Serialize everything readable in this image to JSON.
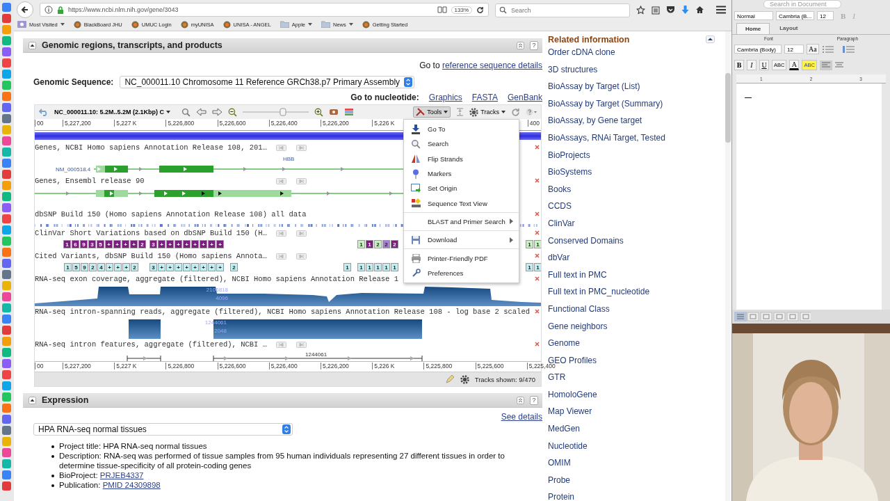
{
  "browser": {
    "url": "https://www.ncbi.nlm.nih.gov/gene/3043",
    "zoom": "133%",
    "search_placeholder": "Search"
  },
  "bookmarks": [
    {
      "label": "Most Visited",
      "kind": "smart",
      "menu": true
    },
    {
      "label": "BlackBoard JHU",
      "kind": "site",
      "menu": false
    },
    {
      "label": "UMUC Login",
      "kind": "site",
      "menu": false
    },
    {
      "label": "myUNISA",
      "kind": "site",
      "menu": false
    },
    {
      "label": "UNISA - ANGEL",
      "kind": "site",
      "menu": false
    },
    {
      "label": "Apple",
      "kind": "folder",
      "menu": true
    },
    {
      "label": "News",
      "kind": "folder",
      "menu": true
    },
    {
      "label": "Getting Started",
      "kind": "site",
      "menu": false
    }
  ],
  "genomic": {
    "title": "Genomic regions, transcripts, and products",
    "help": "?",
    "goto": "Go to",
    "goto_link": "reference sequence details",
    "sequence_label": "Genomic Sequence:",
    "sequence_value": "NC_000011.10 Chromosome 11 Reference GRCh38.p7 Primary Assembly",
    "nucleotide_label": "Go to nucleotide:",
    "nucleotide_links": [
      "Graphics",
      "FASTA",
      "GenBank"
    ]
  },
  "viewer": {
    "region": "NC_000011.10: 5.2M..5.2M (2.1Kbp) C",
    "tools": "Tools",
    "tools_open": true,
    "zoom_slider": {
      "level": 0.62
    },
    "tracks_button": "Tracks",
    "top_ruler": [
      "00",
      "5,227,200",
      "5,227 K",
      "5,226,800",
      "5,226,600",
      "5,226,400",
      "5,226,200",
      "5,226 K",
      "400"
    ],
    "tracks": [
      {
        "title": "Genes, NCBI Homo sapiens Annotation Release 108, 201…",
        "kind": "gene",
        "nav_buttons": true,
        "labels": [
          "NM_000518.4",
          "HBB"
        ]
      },
      {
        "title": "Genes, Ensembl release 90",
        "kind": "gene",
        "nav_buttons": true
      },
      {
        "title": "dbSNP Build 150 (Homo sapiens Annotation Release 108) all data",
        "kind": "snp",
        "nav_buttons": false
      },
      {
        "title": "ClinVar Short Variations based on dbSNP Build 150 (H…",
        "kind": "variant",
        "nav_buttons": true,
        "groups": [
          {
            "color": "#7a1f7d",
            "labels": [
              "1",
              "6",
              "9",
              "3",
              "5",
              "+",
              "+",
              "+",
              "+",
              "2"
            ]
          },
          {
            "color": "#7a1f7d",
            "labels": [
              "3",
              "+",
              "+",
              "+",
              "+",
              "+",
              "+",
              "+",
              "+"
            ]
          },
          {
            "color": "#c8f2c2",
            "labels": [
              "1"
            ]
          },
          {
            "color": "#7a1f7d",
            "labels": [
              "1"
            ]
          },
          {
            "color": "#c8f2c2",
            "labels": [
              "2"
            ]
          },
          {
            "color": "#a77fd9",
            "labels": [
              "2"
            ]
          },
          {
            "color": "#7a1f7d",
            "labels": [
              "2"
            ]
          },
          {
            "color": "#c8f2c2",
            "labels": [
              "1",
              "1"
            ]
          }
        ]
      },
      {
        "title": "Cited Variants, dbSNP Build 150 (Homo sapiens Annota…",
        "kind": "variant",
        "nav_buttons": true,
        "groups": [
          {
            "color": "#bff0f4",
            "labels": [
              "1",
              "5",
              "9",
              "2",
              "4",
              "+",
              "+",
              "+",
              "2"
            ]
          },
          {
            "color": "#bff0f4",
            "labels": [
              "3",
              "+",
              "+",
              "+",
              "+",
              "+",
              "+",
              "+",
              "+"
            ]
          },
          {
            "color": "#bff0f4",
            "labels": [
              "2"
            ]
          },
          {
            "color": "#bff0f4",
            "labels": [
              "1"
            ]
          },
          {
            "color": "#bff0f4",
            "labels": [
              "1",
              "1",
              "1",
              "1",
              "1"
            ]
          },
          {
            "color": "#bff0f4",
            "labels": [
              "1",
              "1"
            ]
          }
        ]
      },
      {
        "title": "RNA-seq exon coverage, aggregate (filtered), NCBI Homo sapiens Annotation Release 1",
        "kind": "coverage",
        "nav_buttons": false,
        "labels": [
          "2106818",
          "4096"
        ]
      },
      {
        "title": "RNA-seq intron-spanning reads, aggregate (filtered), NCBI Homo sapiens Annotation Release 108 - log base 2 scaled",
        "kind": "intron",
        "nav_buttons": false,
        "labels": [
          "1244061",
          "2048"
        ]
      },
      {
        "title": "RNA-seq intron features, aggregate (filtered), NCBI …",
        "kind": "features",
        "nav_buttons": true,
        "labels": [
          "1244061"
        ]
      }
    ],
    "bottom_ruler": [
      "00",
      "5,227,200",
      "5,227 K",
      "5,226,800",
      "5,226,600",
      "5,226,400",
      "5,226,200",
      "5,226 K",
      "5,225,800",
      "5,225,600",
      "5,225,400"
    ],
    "status": "Tracks shown: 9/470",
    "menu": [
      {
        "label": "Go To",
        "submenu": false,
        "separator_before": false
      },
      {
        "label": "Search",
        "submenu": false,
        "separator_before": false
      },
      {
        "label": "Flip Strands",
        "submenu": false,
        "separator_before": false
      },
      {
        "label": "Markers",
        "submenu": false,
        "separator_before": false
      },
      {
        "label": "Set Origin",
        "submenu": false,
        "separator_before": false
      },
      {
        "label": "Sequence Text View",
        "submenu": false,
        "separator_before": false
      },
      {
        "label": "BLAST and Primer Search",
        "submenu": true,
        "separator_before": true
      },
      {
        "label": "Download",
        "submenu": true,
        "separator_before": true
      },
      {
        "label": "Printer-Friendly PDF",
        "submenu": false,
        "separator_before": true
      },
      {
        "label": "Preferences",
        "submenu": false,
        "separator_before": false
      }
    ]
  },
  "expression": {
    "title": "Expression",
    "help": "?",
    "see_details": "See details",
    "select": "HPA RNA-seq normal tissues",
    "bullets": [
      {
        "label": "Project title:",
        "text": "HPA RNA-seq normal tissues"
      },
      {
        "label": "Description:",
        "text": "RNA-seq was performed of tissue samples from 95 human individuals representing 27 different tissues in order to determine tissue-specificity of all protein-coding genes"
      },
      {
        "label": "BioProject:",
        "link": "PRJEB4337"
      },
      {
        "label": "Publication:",
        "link": "PMID 24309898"
      }
    ]
  },
  "related": {
    "title": "Related information",
    "items": [
      "Order cDNA clone",
      "3D structures",
      "BioAssay by Target (List)",
      "BioAssay by Target (Summary)",
      "BioAssay, by Gene target",
      "BioAssays, RNAi Target, Tested",
      "BioProjects",
      "BioSystems",
      "Books",
      "CCDS",
      "ClinVar",
      "Conserved Domains",
      "dbVar",
      "Full text in PMC",
      "Full text in PMC_nucleotide",
      "Functional Class",
      "Gene neighbors",
      "Genome",
      "GEO Profiles",
      "GTR",
      "HomoloGene",
      "Map Viewer",
      "MedGen",
      "Nucleotide",
      "OMIM",
      "Probe",
      "Protein"
    ]
  },
  "word": {
    "search_placeholder": "Search in Document",
    "style": "Normal",
    "font_short": "Cambria (B...",
    "size_short": "12",
    "top_letters": [
      "B",
      "I"
    ],
    "tabs": [
      {
        "label": "Home",
        "selected": true
      },
      {
        "label": "Layout",
        "selected": false
      }
    ],
    "groups": [
      "Font",
      "Paragraph"
    ],
    "font": "Cambria (Body)",
    "size": "12",
    "grow_font": "Aa",
    "format_buttons": [
      "B",
      "I",
      "U",
      "ABC"
    ],
    "font_color": "A",
    "highlight": "ABC",
    "ruler_marks": [
      "1",
      "2",
      "3"
    ]
  }
}
